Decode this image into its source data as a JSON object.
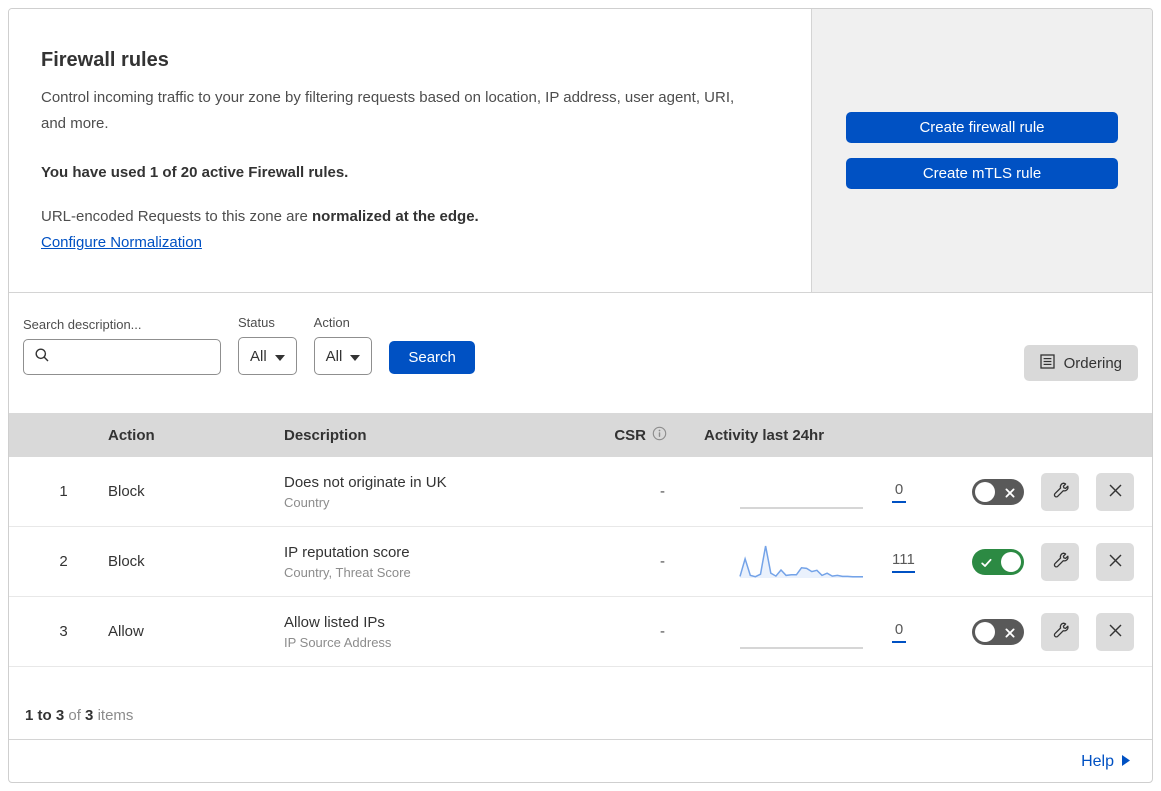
{
  "header": {
    "title": "Firewall rules",
    "description": "Control incoming traffic to your zone by filtering requests based on location, IP address, user agent, URI, and more.",
    "usage_line": "You have used 1 of 20 active Firewall rules.",
    "normalization_prefix": "URL-encoded Requests to this zone are ",
    "normalization_bold": "normalized at the edge.",
    "normalization_link": "Configure Normalization",
    "buttons": [
      {
        "label": "Create firewall rule"
      },
      {
        "label": "Create mTLS rule"
      }
    ]
  },
  "filters": {
    "search_label": "Search description...",
    "search_value": "",
    "status_label": "Status",
    "status_value": "All",
    "action_label": "Action",
    "action_value": "All",
    "search_button": "Search",
    "ordering_button": "Ordering"
  },
  "table": {
    "columns": {
      "action": "Action",
      "description": "Description",
      "csr": "CSR",
      "activity": "Activity last 24hr"
    },
    "rows": [
      {
        "num": "1",
        "action": "Block",
        "description": "Does not originate in UK",
        "fields": "Country",
        "csr": "-",
        "count": "0",
        "enabled": false,
        "sparkline": [
          0,
          0,
          0,
          0,
          0,
          0,
          0,
          0,
          0,
          0,
          0,
          0,
          0,
          0,
          0,
          0,
          0,
          0,
          0,
          0,
          0,
          0,
          0,
          0,
          0
        ]
      },
      {
        "num": "2",
        "action": "Block",
        "description": "IP reputation score",
        "fields": "Country, Threat Score",
        "csr": "-",
        "count": "111",
        "enabled": true,
        "sparkline": [
          5,
          60,
          8,
          4,
          12,
          100,
          15,
          6,
          25,
          8,
          10,
          10,
          32,
          30,
          20,
          24,
          8,
          15,
          6,
          8,
          5,
          5,
          4,
          4,
          4
        ]
      },
      {
        "num": "3",
        "action": "Allow",
        "description": "Allow listed IPs",
        "fields": "IP Source Address",
        "csr": "-",
        "count": "0",
        "enabled": false,
        "sparkline": [
          0,
          0,
          0,
          0,
          0,
          0,
          0,
          0,
          0,
          0,
          0,
          0,
          0,
          0,
          0,
          0,
          0,
          0,
          0,
          0,
          0,
          0,
          0,
          0,
          0
        ]
      }
    ],
    "summary": {
      "range": "1 to 3",
      "of_word": "of",
      "total": "3",
      "items_word": "items"
    }
  },
  "footer": {
    "help_label": "Help"
  },
  "colors": {
    "accent_blue": "#0051c3",
    "toggle_on_green": "#2c8a43",
    "toggle_off_gray": "#595959",
    "table_header_gray": "#d9d9d9",
    "panel_gray": "#f0f0f0",
    "sparkline_active": "#74a3e8",
    "sparkline_fill": "rgba(116,163,232,0.15)",
    "sparkline_flat": "#c9c9c9"
  }
}
